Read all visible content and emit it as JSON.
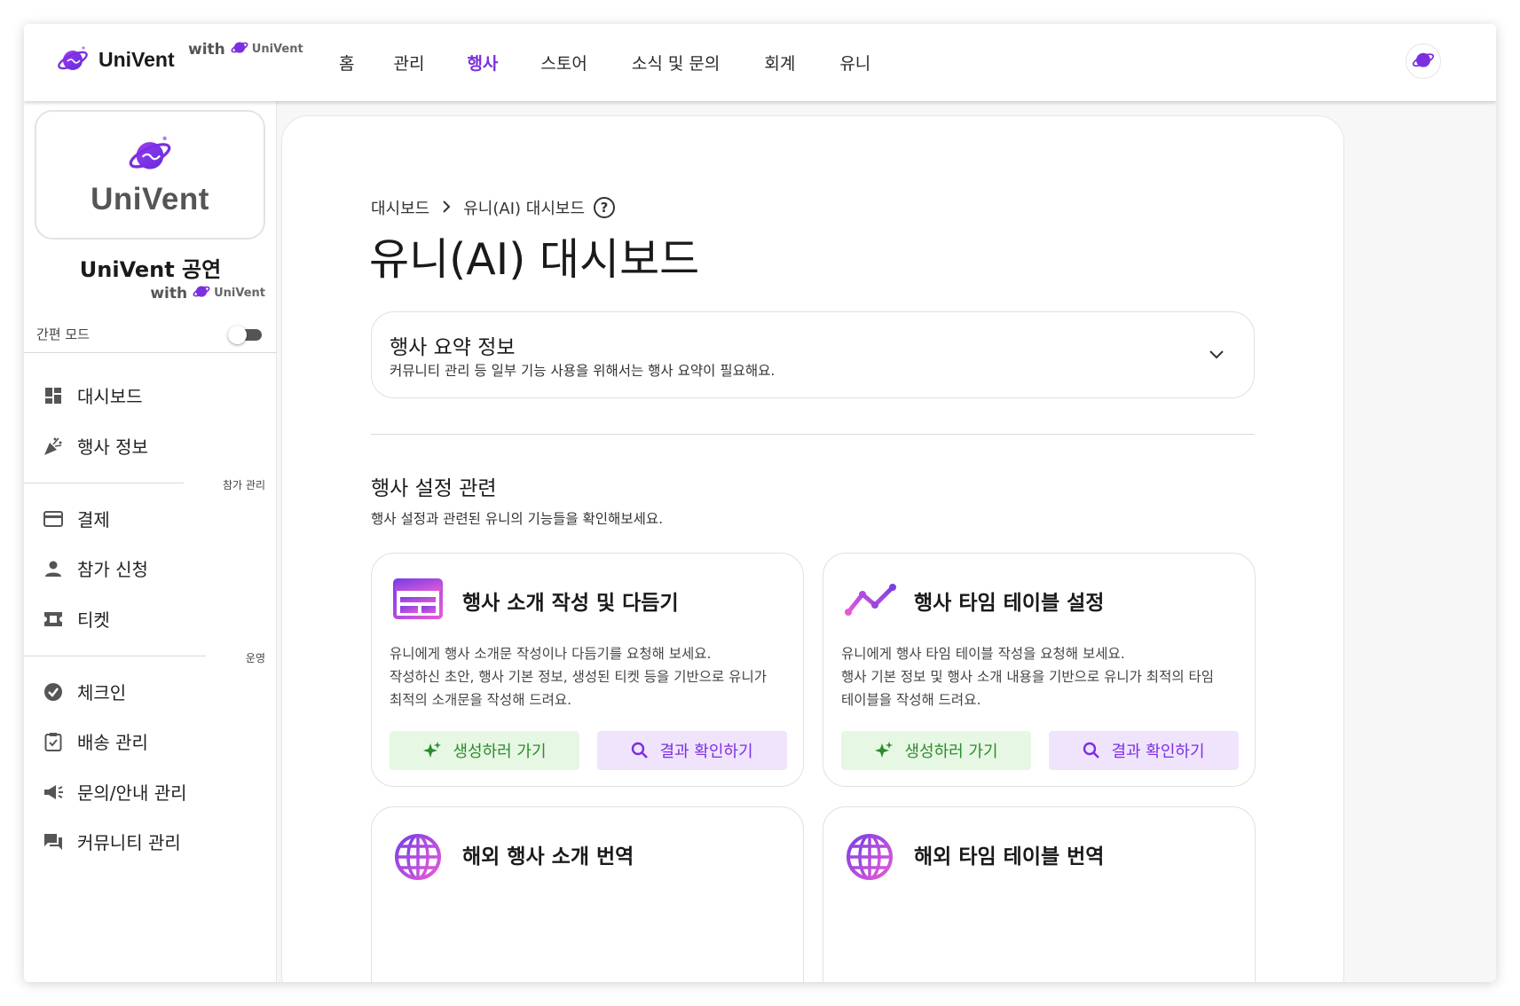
{
  "app": {
    "brand_name": "UniVent",
    "with_text": "with",
    "partner_name": "UniVent"
  },
  "topnav": {
    "items": [
      {
        "label": "홈",
        "active": false
      },
      {
        "label": "관리",
        "active": false
      },
      {
        "label": "행사",
        "active": true
      },
      {
        "label": "스토어",
        "active": false
      },
      {
        "label": "소식 및 문의",
        "active": false
      },
      {
        "label": "회계",
        "active": false
      },
      {
        "label": "유니",
        "active": false
      }
    ]
  },
  "sidebar": {
    "logo_text": "UniVent",
    "org_name": "UniVent 공연",
    "with_text": "with",
    "partner_name": "UniVent",
    "simple_mode_label": "간편 모드",
    "simple_mode_on": false,
    "items": [
      {
        "label": "대시보드",
        "icon": "dashboard-icon"
      },
      {
        "label": "행사 정보",
        "icon": "celebration-icon"
      },
      {
        "label": "결제",
        "icon": "credit-card-icon"
      },
      {
        "label": "참가 신청",
        "icon": "person-icon"
      },
      {
        "label": "티켓",
        "icon": "ticket-icon"
      },
      {
        "label": "체크인",
        "icon": "check-circle-icon"
      },
      {
        "label": "배송 관리",
        "icon": "clipboard-icon"
      },
      {
        "label": "문의/안내 관리",
        "icon": "megaphone-icon"
      },
      {
        "label": "커뮤니티 관리",
        "icon": "forum-icon"
      }
    ],
    "sections": [
      "참가 관리",
      "운영"
    ]
  },
  "main": {
    "breadcrumb": [
      "대시보드",
      "유니(AI) 대시보드"
    ],
    "help_glyph": "?",
    "title": "유니(AI) 대시보드",
    "summary": {
      "title": "행사 요약 정보",
      "subtitle": "커뮤니티 관리 등 일부 기능 사용을 위해서는 행사 요약이 필요해요."
    },
    "section": {
      "title": "행사 설정 관련",
      "subtitle": "행사 설정과 관련된 유니의 기능들을 확인해보세요."
    },
    "features": [
      {
        "title": "행사 소개 작성 및 다듬기",
        "icon": "layout-icon",
        "desc": [
          "유니에게 행사 소개문 작성이나 다듬기를 요청해 보세요.",
          "작성하신 초안, 행사 기본 정보, 생성된 티켓 등을 기반으로 유니가",
          "최적의 소개문을 작성해 드려요."
        ],
        "primary": "생성하러 가기",
        "secondary": "결과 확인하기"
      },
      {
        "title": "행사 타임 테이블 설정",
        "icon": "timeline-icon",
        "desc": [
          "유니에게 행사 타임 테이블 작성을 요청해 보세요.",
          "행사 기본 정보 및 행사 소개 내용을 기반으로 유니가 최적의 타임",
          "테이블을 작성해 드려요."
        ],
        "primary": "생성하러 가기",
        "secondary": "결과 확인하기"
      },
      {
        "title": "해외 행사 소개 번역",
        "icon": "globe-icon"
      },
      {
        "title": "해외 타임 테이블 번역",
        "icon": "globe-icon"
      }
    ]
  },
  "colors": {
    "accent": "#7c2fe0",
    "green_bg": "#e6f7e3",
    "green_text": "#2f8a2f",
    "purple_bg": "#f0e4fd"
  }
}
